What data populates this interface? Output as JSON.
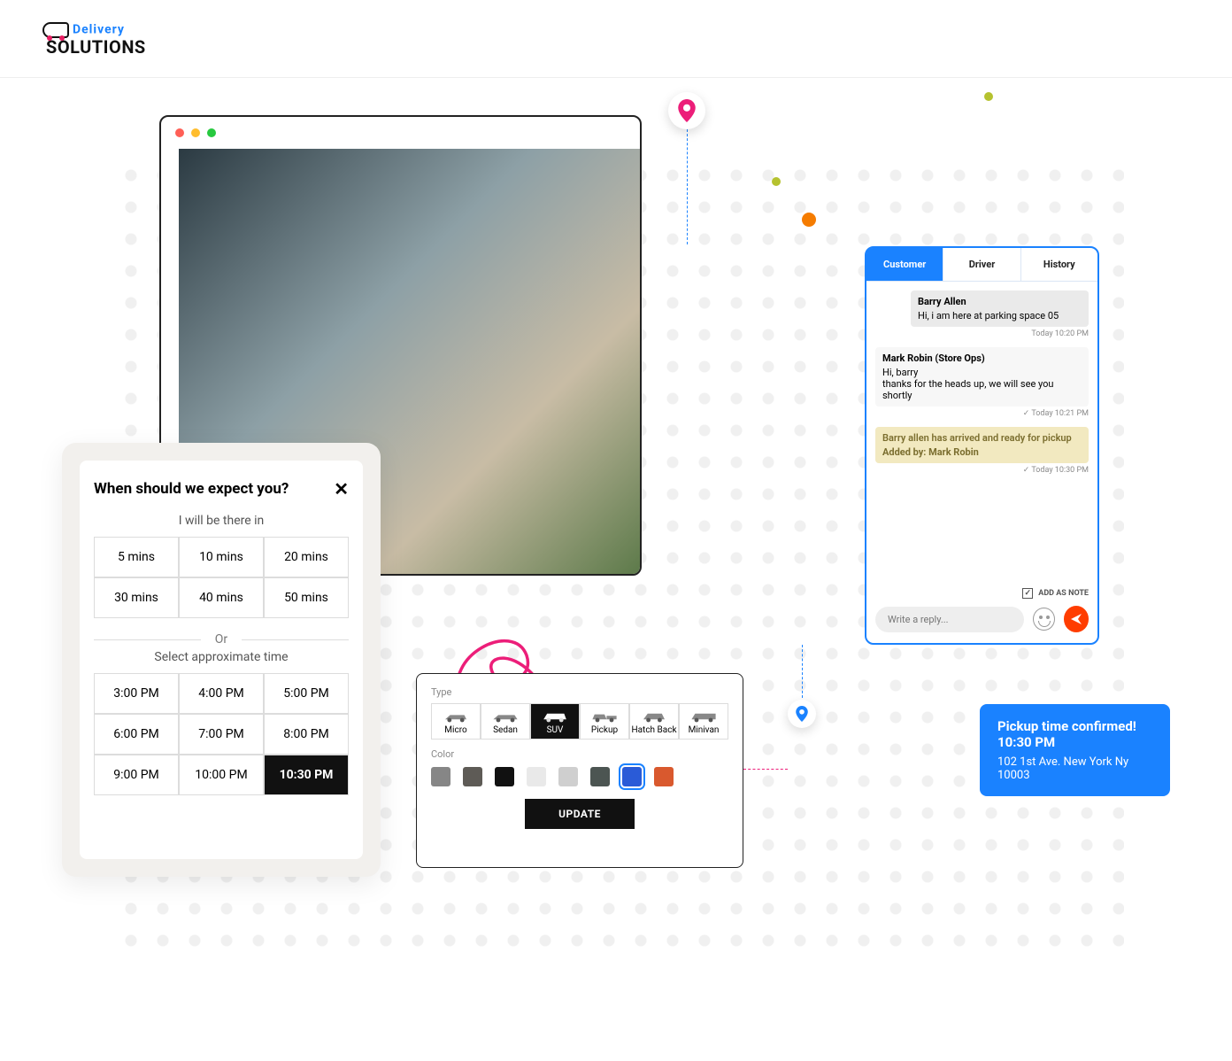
{
  "logo": {
    "top": "Delivery",
    "bottom": "OLUTIONS"
  },
  "chat": {
    "tabs": [
      "Customer",
      "Driver",
      "History"
    ],
    "msg1": {
      "name": "Barry Allen",
      "text": "Hi, i am here at parking space 05",
      "time": "Today 10:20 PM"
    },
    "msg2": {
      "name": "Mark Robin (Store Ops)",
      "greeting": "Hi, barry",
      "text": "thanks for the heads up, we will see you shortly",
      "time": "Today 10:21 PM"
    },
    "note": {
      "text": "Barry allen has arrived and ready for pickup",
      "added": "Added by: Mark Robin",
      "time": "Today 10:30 PM"
    },
    "addnote_label": "ADD AS NOTE",
    "reply_placeholder": "Write a reply..."
  },
  "eta": {
    "title": "When should we expect you?",
    "sub1": "I will be there in",
    "mins": [
      "5 mins",
      "10 mins",
      "20 mins",
      "30 mins",
      "40 mins",
      "50 mins"
    ],
    "or": "Or",
    "sub2": "Select approximate time",
    "times": [
      "3:00 PM",
      "4:00 PM",
      "5:00 PM",
      "6:00 PM",
      "7:00 PM",
      "8:00 PM",
      "9:00 PM",
      "10:00 PM",
      "10:30 PM"
    ],
    "selected_time": "10:30 PM"
  },
  "vehicle": {
    "type_label": "Type",
    "types": [
      "Micro",
      "Sedan",
      "SUV",
      "Pickup",
      "Hatch Back",
      "Minivan"
    ],
    "selected_type": "SUV",
    "color_label": "Color",
    "colors": [
      "#868686",
      "#5e5b56",
      "#111111",
      "#e9e9e9",
      "#cfcfcf",
      "#4c5552",
      "#2a5bd7",
      "#d9592e"
    ],
    "selected_color": "#2a5bd7",
    "update": "UPDATE"
  },
  "toast": {
    "line1": "Pickup time confirmed!",
    "line2": "10:30 PM",
    "addr": "102 1st Ave. New York Ny 10003"
  }
}
